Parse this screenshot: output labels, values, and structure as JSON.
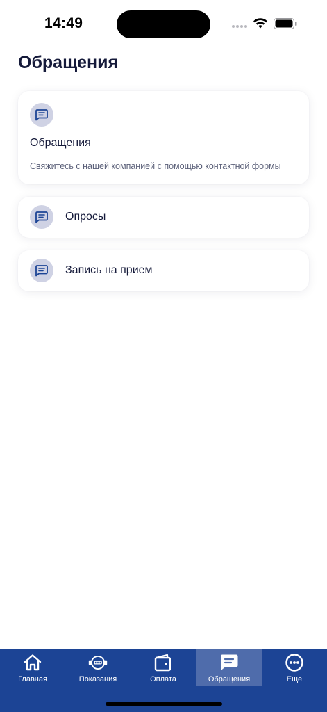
{
  "status_bar": {
    "time": "14:49",
    "icons": [
      "signal-icon",
      "wifi-icon",
      "battery-icon"
    ]
  },
  "header": {
    "title": "Обращения"
  },
  "cards": {
    "appeals": {
      "icon": "message-icon",
      "title": "Обращения",
      "subtitle": "Свяжитесь с нашей компанией с помощью контактной формы"
    },
    "surveys": {
      "icon": "message-icon",
      "label": "Опросы"
    },
    "appointment": {
      "icon": "message-icon",
      "label": "Запись на прием"
    }
  },
  "tab_bar": {
    "active": "Обращения",
    "items": [
      {
        "label": "Главная",
        "icon": "home-icon"
      },
      {
        "label": "Показания",
        "icon": "meter-icon"
      },
      {
        "label": "Оплата",
        "icon": "wallet-icon"
      },
      {
        "label": "Обращения",
        "icon": "message-icon"
      },
      {
        "label": "Еще",
        "icon": "more-icon"
      }
    ]
  },
  "colors": {
    "accent": "#1c4495",
    "active_tab": "#4f6cab",
    "icon_bg": "#cfd2e4",
    "icon_fg": "#1c4495",
    "title_text": "#151a3a",
    "subtitle_text": "#5a5f78"
  }
}
